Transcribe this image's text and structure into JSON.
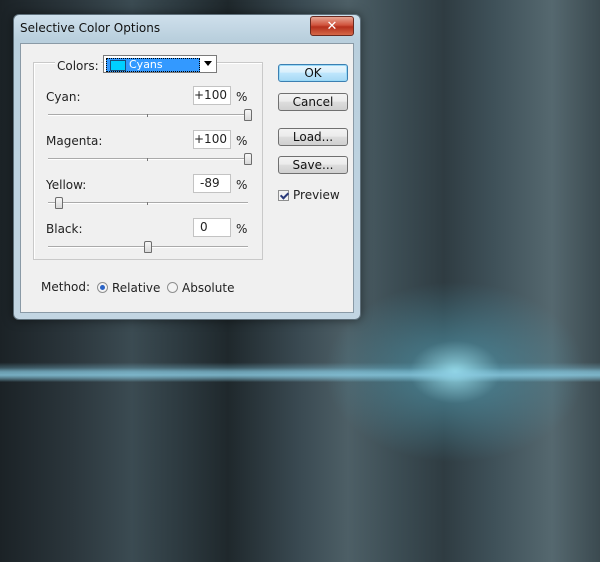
{
  "dialog": {
    "title": "Selective Color Options",
    "close_glyph": "✕"
  },
  "colors": {
    "label": "Colors:",
    "selected": "Cyans",
    "swatch_color": "#00d0ff"
  },
  "sliders": [
    {
      "label": "Cyan:",
      "value": "+100",
      "unit": "%",
      "level": 1.0
    },
    {
      "label": "Magenta:",
      "value": "+100",
      "unit": "%",
      "level": 1.0
    },
    {
      "label": "Yellow:",
      "value": "-89",
      "unit": "%",
      "level": 0.055
    },
    {
      "label": "Black:",
      "value": "0",
      "unit": "%",
      "level": 0.5
    }
  ],
  "buttons": {
    "ok": "OK",
    "cancel": "Cancel",
    "load": "Load...",
    "save": "Save..."
  },
  "preview": {
    "label": "Preview",
    "checked": true
  },
  "method": {
    "label": "Method:",
    "options": [
      {
        "label": "Relative",
        "selected": true
      },
      {
        "label": "Absolute",
        "selected": false
      }
    ]
  }
}
